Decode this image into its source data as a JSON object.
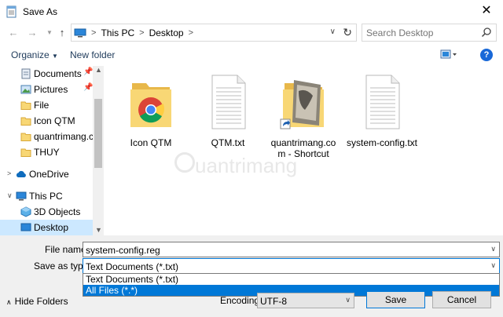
{
  "window": {
    "title": "Save As",
    "close_glyph": "✕"
  },
  "nav": {
    "back_icon": "arrow-left-icon",
    "forward_icon": "arrow-right-icon",
    "recent_icon": "chevron-down-icon",
    "up_icon": "arrow-up-icon",
    "breadcrumb": [
      "This PC",
      "Desktop"
    ],
    "search_placeholder": "Search Desktop"
  },
  "toolbar": {
    "organize_label": "Organize",
    "new_folder_label": "New folder",
    "help_label": "?"
  },
  "sidebar": {
    "items": [
      {
        "label": "Documents",
        "icon": "documents-icon",
        "pinned": true
      },
      {
        "label": "Pictures",
        "icon": "pictures-icon",
        "pinned": true
      },
      {
        "label": "File",
        "icon": "folder-icon",
        "pinned": false
      },
      {
        "label": "Icon QTM",
        "icon": "folder-icon",
        "pinned": false
      },
      {
        "label": "quantrimang.com",
        "icon": "folder-icon",
        "pinned": false
      },
      {
        "label": "THUY",
        "icon": "folder-icon",
        "pinned": false
      },
      {
        "label": "OneDrive",
        "icon": "onedrive-icon",
        "pinned": false
      },
      {
        "label": "This PC",
        "icon": "this-pc-icon",
        "pinned": false
      },
      {
        "label": "3D Objects",
        "icon": "3d-objects-icon",
        "pinned": false
      },
      {
        "label": "Desktop",
        "icon": "desktop-icon",
        "pinned": false,
        "selected": true
      }
    ]
  },
  "files": [
    {
      "name": "Icon QTM",
      "type": "folder-chrome"
    },
    {
      "name": "QTM.txt",
      "type": "text"
    },
    {
      "name": "quantrimang.com - Shortcut",
      "name_line1": "quantrimang.co",
      "name_line2": "m - Shortcut",
      "type": "shortcut"
    },
    {
      "name": "system-config.txt",
      "type": "text"
    }
  ],
  "watermark": "uantrimang",
  "form": {
    "file_name_label": "File name:",
    "file_name_value": "system-config.reg",
    "save_as_type_label": "Save as type:",
    "save_as_type_value": "Text Documents (*.txt)",
    "type_options": [
      "Text Documents (*.txt)",
      "All Files  (*.*)"
    ],
    "selected_option_index": 1,
    "encoding_label": "Encoding:",
    "encoding_value": "UTF-8",
    "save_label": "Save",
    "cancel_label": "Cancel",
    "hide_folders_label": "Hide Folders"
  },
  "colors": {
    "accent": "#0078d7",
    "selection_bg": "#cce8ff",
    "folder": "#f8d775",
    "link": "#1e3a5a"
  }
}
